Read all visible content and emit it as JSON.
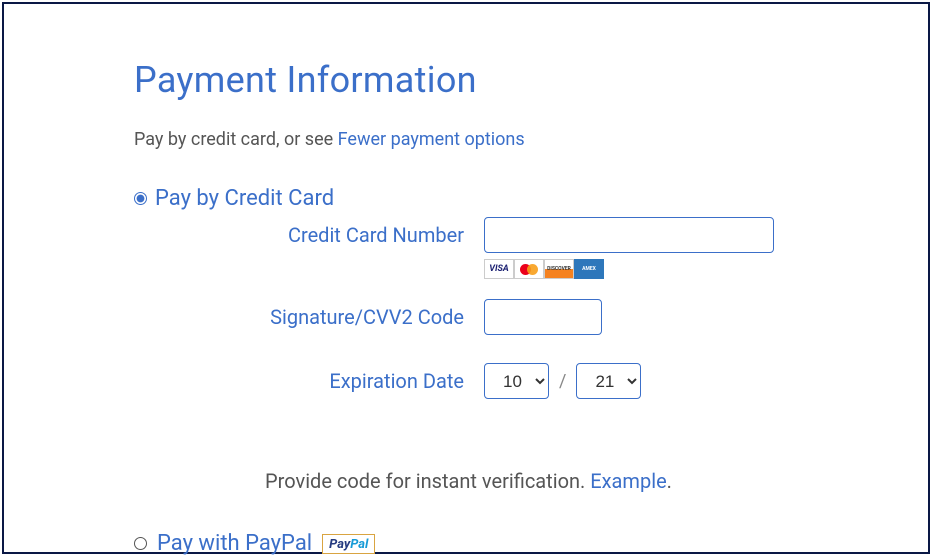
{
  "title": "Payment Information",
  "subtitle_prefix": "Pay by credit card, or see ",
  "subtitle_link": "Fewer payment options",
  "credit_option_label": "Pay by Credit Card",
  "fields": {
    "card_number_label": "Credit Card Number",
    "card_number_value": "",
    "cvv_label": "Signature/CVV2 Code",
    "cvv_value": "",
    "exp_label": "Expiration Date",
    "exp_month": "10",
    "exp_year": "21",
    "separator": "/"
  },
  "card_brands": {
    "visa": "VISA",
    "mastercard": "mastercard",
    "discover": "DISCOVER",
    "amex": "AMEX"
  },
  "verify_prefix": "Provide code for instant verification. ",
  "verify_link": "Example",
  "verify_suffix": ".",
  "paypal_option_label": "Pay with PayPal",
  "paypal_logo": {
    "pay": "Pay",
    "pal": "Pal"
  }
}
